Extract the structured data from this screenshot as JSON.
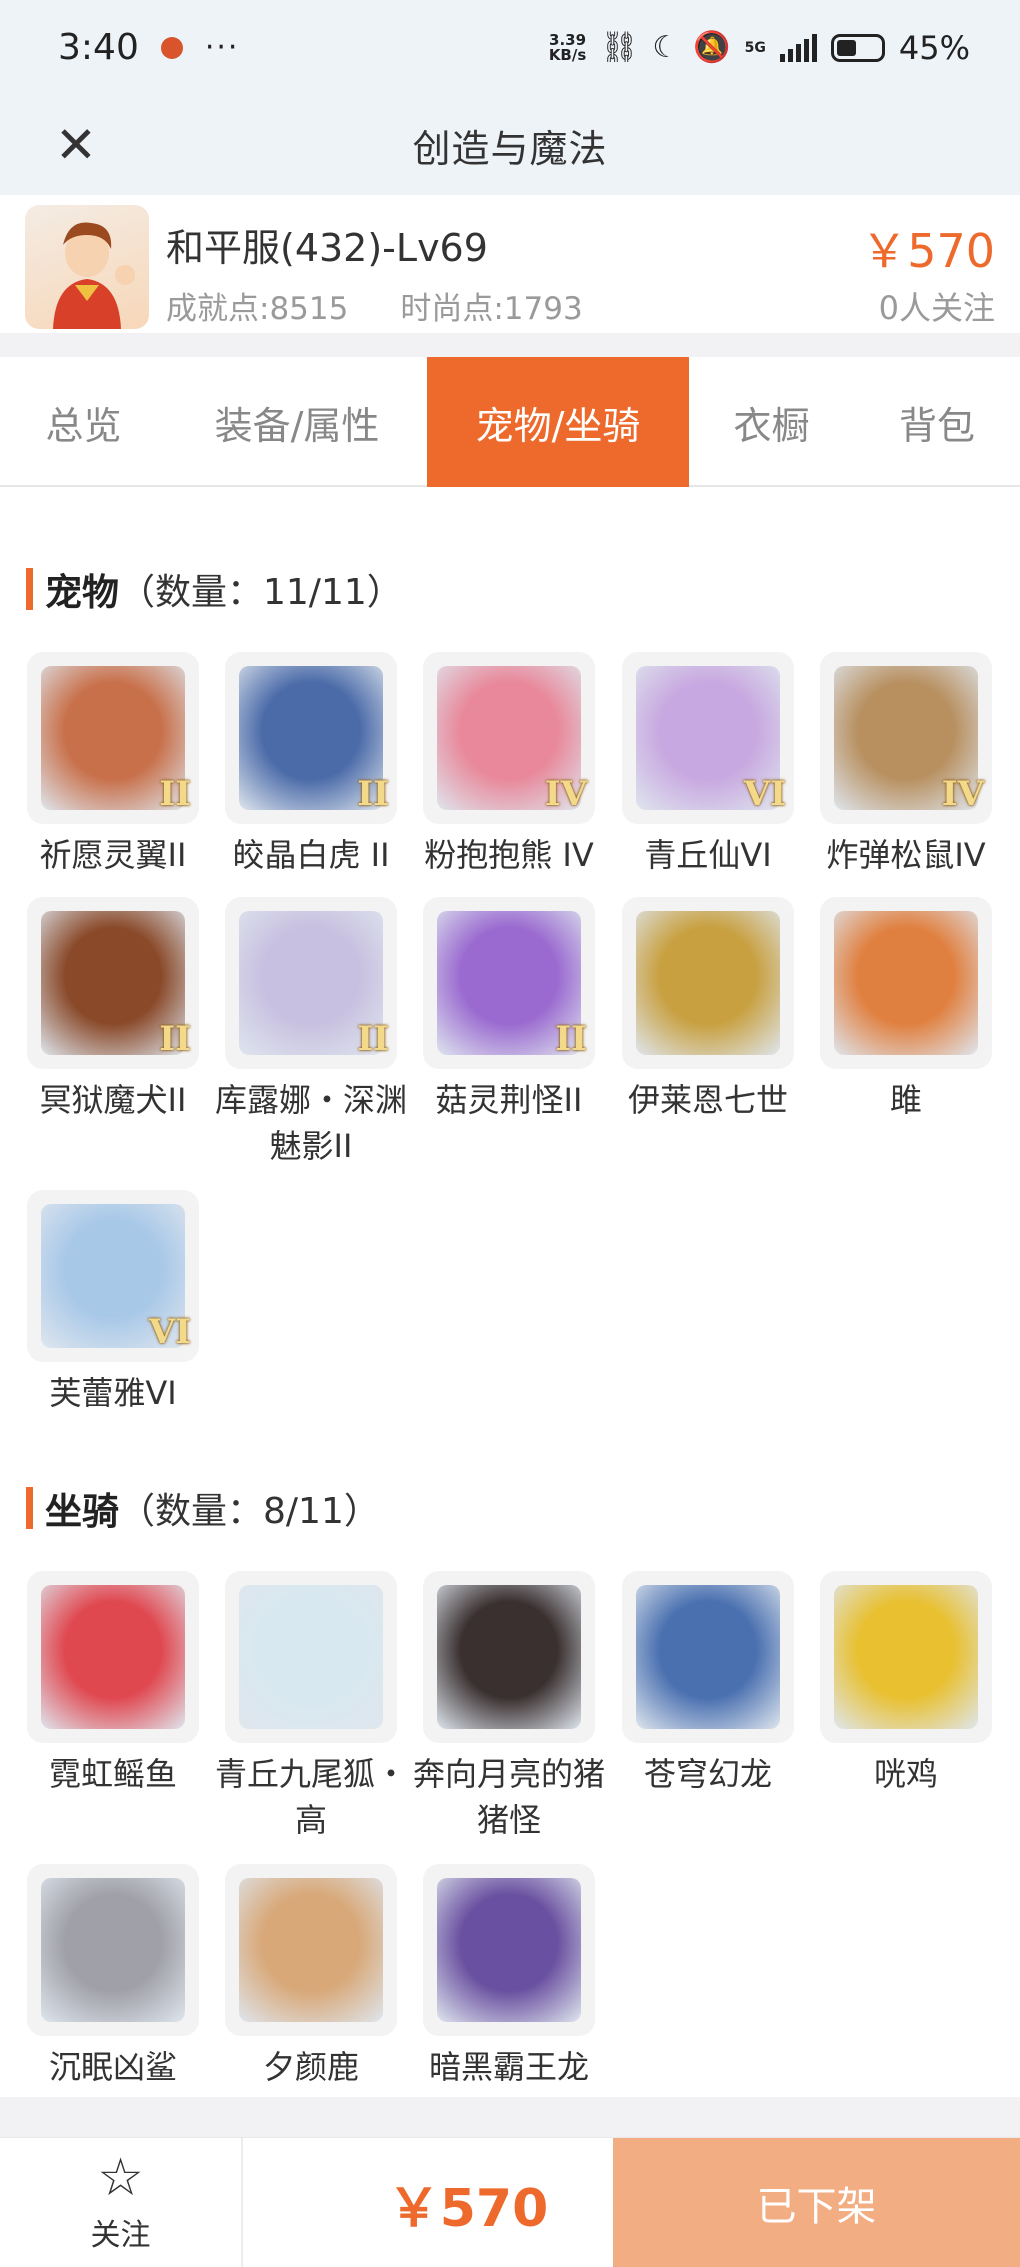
{
  "status_bar": {
    "time": "3:40",
    "more": "···",
    "speed": "3.39",
    "speed_unit": "KB/s",
    "network": "5G",
    "battery": "45%",
    "battery_level": 0.45
  },
  "header": {
    "title": "创造与魔法",
    "close_icon": "close-icon"
  },
  "account": {
    "name": "和平服(432)-Lv69",
    "achievement": "成就点:8515",
    "fashion": "时尚点:1793",
    "price": "￥570",
    "followers": "0人关注"
  },
  "tabs": [
    {
      "label": "总览",
      "active": false
    },
    {
      "label": "装备/属性",
      "active": false
    },
    {
      "label": "宠物/坐骑",
      "active": true
    },
    {
      "label": "衣橱",
      "active": false
    },
    {
      "label": "背包",
      "active": false
    }
  ],
  "pets": {
    "title": "宠物",
    "count": "（数量：11/11）",
    "items": [
      {
        "name": "祈愿灵翼II",
        "badge": "II",
        "color": "#c8704a"
      },
      {
        "name": "皎晶白虎 II",
        "badge": "II",
        "color": "#4a6aa8"
      },
      {
        "name": "粉抱抱熊 IV",
        "badge": "IV",
        "color": "#e8889a"
      },
      {
        "name": "青丘仙VI",
        "badge": "VI",
        "color": "#c8a8e0"
      },
      {
        "name": "炸弹松鼠IV",
        "badge": "IV",
        "color": "#b89060"
      },
      {
        "name": "冥狱魔犬II",
        "badge": "II",
        "color": "#8a4a2a"
      },
      {
        "name": "库露娜・深渊魅影II",
        "badge": "II",
        "color": "#c8c0e0"
      },
      {
        "name": "菇灵荆怪II",
        "badge": "II",
        "color": "#9a6ad0"
      },
      {
        "name": "伊莱恩七世",
        "badge": "",
        "color": "#c8a040"
      },
      {
        "name": "雎",
        "badge": "",
        "color": "#e08040"
      },
      {
        "name": "芙蕾雅VI",
        "badge": "VI",
        "color": "#a8c8e8"
      }
    ]
  },
  "mounts": {
    "title": "坐骑",
    "count": "（数量：8/11）",
    "items": [
      {
        "name": "霓虹鳐鱼",
        "color": "#e04850"
      },
      {
        "name": "青丘九尾狐・高",
        "color": "#d8e8f0"
      },
      {
        "name": "奔向月亮的猪猪怪",
        "color": "#3a3030"
      },
      {
        "name": "苍穹幻龙",
        "color": "#4a70b0"
      },
      {
        "name": "咣鸡",
        "color": "#e8c030"
      },
      {
        "name": "沉眠凶鲨",
        "color": "#a0a0a8"
      },
      {
        "name": "夕颜鹿",
        "color": "#d8a878"
      },
      {
        "name": "暗黑霸王龙",
        "color": "#6a50a0"
      }
    ]
  },
  "bottom": {
    "follow": "关注",
    "price": "￥570",
    "status": "已下架"
  },
  "colors": {
    "accent": "#ee6a2c",
    "status_button": "#f2ad83"
  }
}
